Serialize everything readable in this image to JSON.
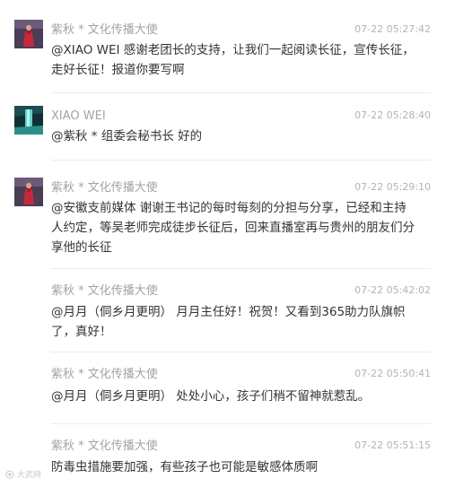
{
  "comments": [
    {
      "author": "紫秋 * 文化传播大使",
      "time": "07-22 05:27:42",
      "text": "@XIAO  WEI 感谢老团长的支持，让我们一起阅读长征，宣传长征，走好长征！报道你要写啊",
      "avatar": "avatar-red-figure"
    },
    {
      "author": "XIAO  WEI",
      "time": "07-22 05:28:40",
      "text": "@紫秋 * 组委会秘书长 好的",
      "avatar": "avatar-teal-waterfall"
    },
    {
      "author": "紫秋 * 文化传播大使",
      "time": "07-22 05:29:10",
      "text": "@安徽支前媒体 谢谢王书记的每时每刻的分担与分享，已经和主持人约定，等吴老师完成徒步长征后，回来直播室再与贵州的朋友们分享他的长征",
      "avatar": "avatar-red-figure"
    },
    {
      "author": "紫秋 * 文化传播大使",
      "time": "07-22 05:42:02",
      "text": "@月月（侗乡月更明） 月月主任好！祝贺！又看到365助力队旗帜了，真好！"
    },
    {
      "author": "紫秋 * 文化传播大使",
      "time": "07-22 05:50:41",
      "text": "@月月（侗乡月更明） 处处小心，孩子们稍不留神就惹乱。"
    },
    {
      "author": "紫秋 * 文化传播大使",
      "time": "07-22 05:51:15",
      "text": "防毒虫措施要加强，有些孩子也可能是敏感体质啊"
    }
  ],
  "watermark": {
    "text": "大武网",
    "icon": "watermark-logo-icon"
  },
  "colors": {
    "author": "#a3a3a3",
    "time": "#b3b3b3",
    "text": "#333333",
    "divider": "#ececec"
  }
}
